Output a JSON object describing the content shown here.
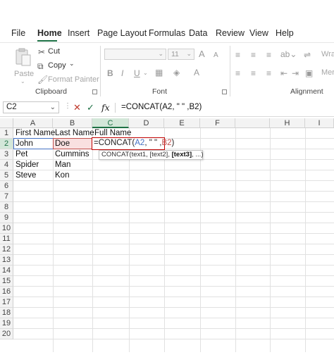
{
  "menu": {
    "tabs": [
      "File",
      "Home",
      "Insert",
      "Page Layout",
      "Formulas",
      "Data",
      "Review",
      "View",
      "Help"
    ],
    "active": "Home"
  },
  "ribbon": {
    "clipboard": {
      "paste_label": "Paste",
      "cut_label": "Cut",
      "copy_label": "Copy",
      "format_painter_label": "Format Painter",
      "group_label": "Clipboard"
    },
    "font": {
      "font_size": "11",
      "group_label": "Font",
      "bold": "B",
      "italic": "I",
      "underline": "U",
      "grow": "A",
      "shrink": "A"
    },
    "alignment": {
      "wrap_label": "Wra",
      "merge_label": "Mer",
      "group_label": "Alignment"
    }
  },
  "formula_bar": {
    "name_box": "C2",
    "cancel_glyph": "✕",
    "enter_glyph": "✓",
    "fx_label": "fx",
    "formula": "=CONCAT(A2, \" \" ,B2)"
  },
  "sheet": {
    "columns": [
      "A",
      "B",
      "C",
      "D",
      "E",
      "F",
      "H",
      "I"
    ],
    "selected_column": "C",
    "rows": [
      "1",
      "2",
      "3",
      "4",
      "5",
      "6",
      "7",
      "8",
      "9",
      "10",
      "11",
      "12",
      "13",
      "14",
      "15",
      "16",
      "17",
      "18",
      "19",
      "20"
    ],
    "selected_row": "2",
    "cells": {
      "A1": "First Name",
      "B1": "Last  Name",
      "C1": "Full Name",
      "A2": "John",
      "B2": "Doe",
      "A3": "Pet",
      "B3": "Cummins",
      "A4": "Spider",
      "B4": "Man",
      "A5": "Steve",
      "B5": "Kon"
    },
    "edit": {
      "prefix": "=CONCAT(",
      "ref_a": "A2",
      "middle": ", \" \" ,",
      "ref_b": "B2",
      "suffix": ")"
    },
    "tooltip": {
      "before": "CONCAT(text1, [text2], ",
      "current": "[text3]",
      "after": ", ...)"
    }
  },
  "colors": {
    "accent": "#1e7145",
    "ref_a": "#4472c4",
    "ref_b": "#c0504d",
    "edit_border": "#c00000"
  }
}
